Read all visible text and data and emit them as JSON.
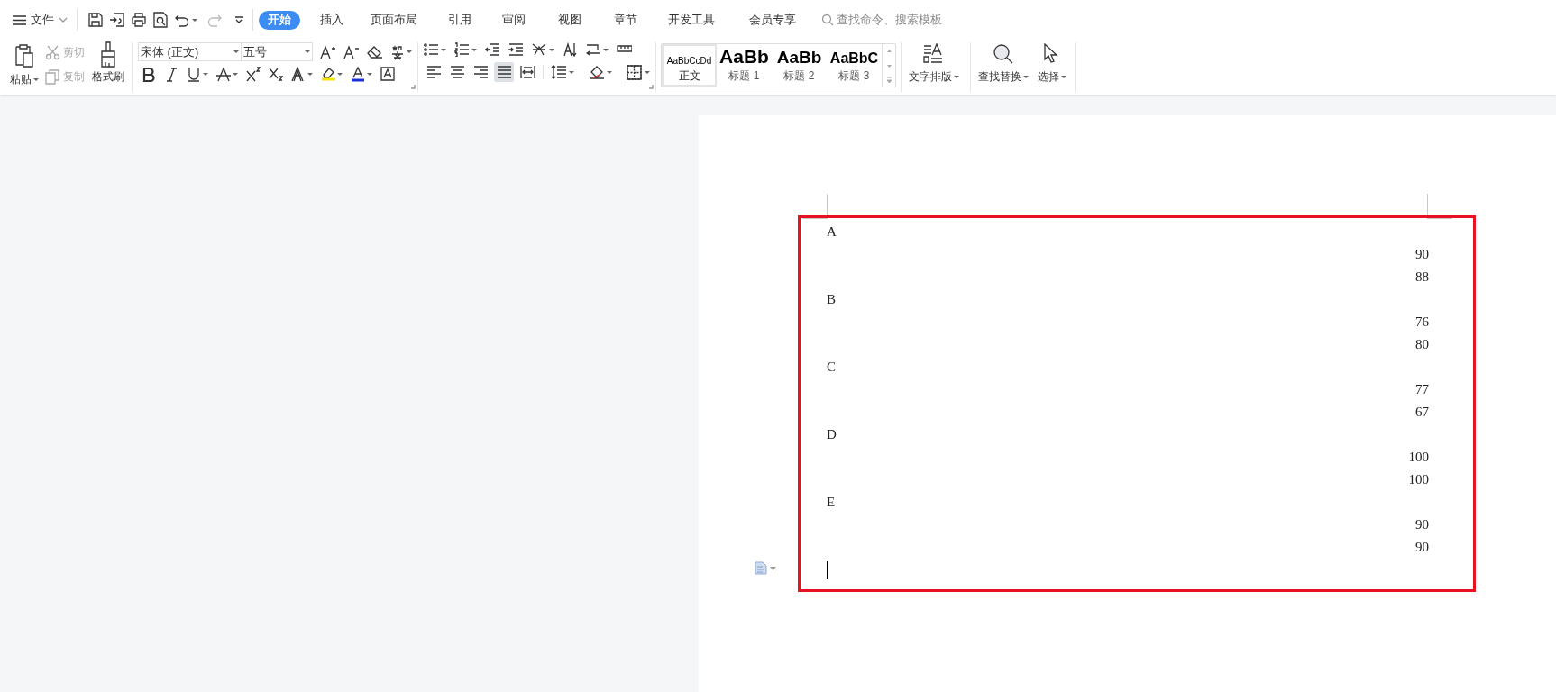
{
  "menu": {
    "label": "文件"
  },
  "quick_access": [
    {
      "kind": "save",
      "disabled": false
    },
    {
      "kind": "export",
      "disabled": false
    },
    {
      "kind": "print",
      "disabled": false
    },
    {
      "kind": "preview",
      "disabled": false
    },
    {
      "kind": "undo",
      "disabled": false
    },
    {
      "kind": "redo",
      "disabled": true
    }
  ],
  "tabs": [
    {
      "label": "开始",
      "selected": true
    },
    {
      "label": "插入",
      "selected": false
    },
    {
      "label": "页面布局",
      "selected": false
    },
    {
      "label": "引用",
      "selected": false
    },
    {
      "label": "审阅",
      "selected": false
    },
    {
      "label": "视图",
      "selected": false
    },
    {
      "label": "章节",
      "selected": false
    },
    {
      "label": "开发工具",
      "selected": false
    },
    {
      "label": "会员专享",
      "selected": false
    }
  ],
  "search": {
    "placeholder": "查找命令、搜索模板"
  },
  "clipboard": {
    "paste": "粘贴",
    "cut": {
      "label": "剪切",
      "disabled": true
    },
    "copy": {
      "label": "复制",
      "disabled": true
    },
    "format_painter": "格式刷"
  },
  "font": {
    "name": "宋体 (正文)",
    "size": "五号"
  },
  "alignment_buttons": [
    {
      "kind": "left",
      "selected": false
    },
    {
      "kind": "center",
      "selected": false
    },
    {
      "kind": "right",
      "selected": false
    },
    {
      "kind": "justify",
      "selected": true
    },
    {
      "kind": "distributed",
      "selected": false
    }
  ],
  "styles": [
    {
      "preview": "AaBbCcDd",
      "label": "正文",
      "selected": true
    },
    {
      "preview": "AaBb",
      "label": "标题 1",
      "selected": false
    },
    {
      "preview": "AaBb",
      "label": "标题 2",
      "selected": false
    },
    {
      "preview": "AaBbC",
      "label": "标题 3",
      "selected": false
    }
  ],
  "tools": [
    {
      "kind": "layout",
      "label": "文字排版"
    },
    {
      "kind": "find",
      "label": "查找替换"
    },
    {
      "kind": "select",
      "label": "选择"
    }
  ],
  "document": {
    "lines": [
      {
        "kind": "label",
        "text": "A"
      },
      {
        "kind": "value",
        "text": "90"
      },
      {
        "kind": "value",
        "text": "88"
      },
      {
        "kind": "label",
        "text": "B"
      },
      {
        "kind": "value",
        "text": "76"
      },
      {
        "kind": "value",
        "text": "80"
      },
      {
        "kind": "label",
        "text": "C"
      },
      {
        "kind": "value",
        "text": "77"
      },
      {
        "kind": "value",
        "text": "67"
      },
      {
        "kind": "label",
        "text": "D"
      },
      {
        "kind": "value",
        "text": "100"
      },
      {
        "kind": "value",
        "text": "100"
      },
      {
        "kind": "label",
        "text": "E"
      },
      {
        "kind": "value",
        "text": "90"
      },
      {
        "kind": "value",
        "text": "90"
      }
    ]
  }
}
